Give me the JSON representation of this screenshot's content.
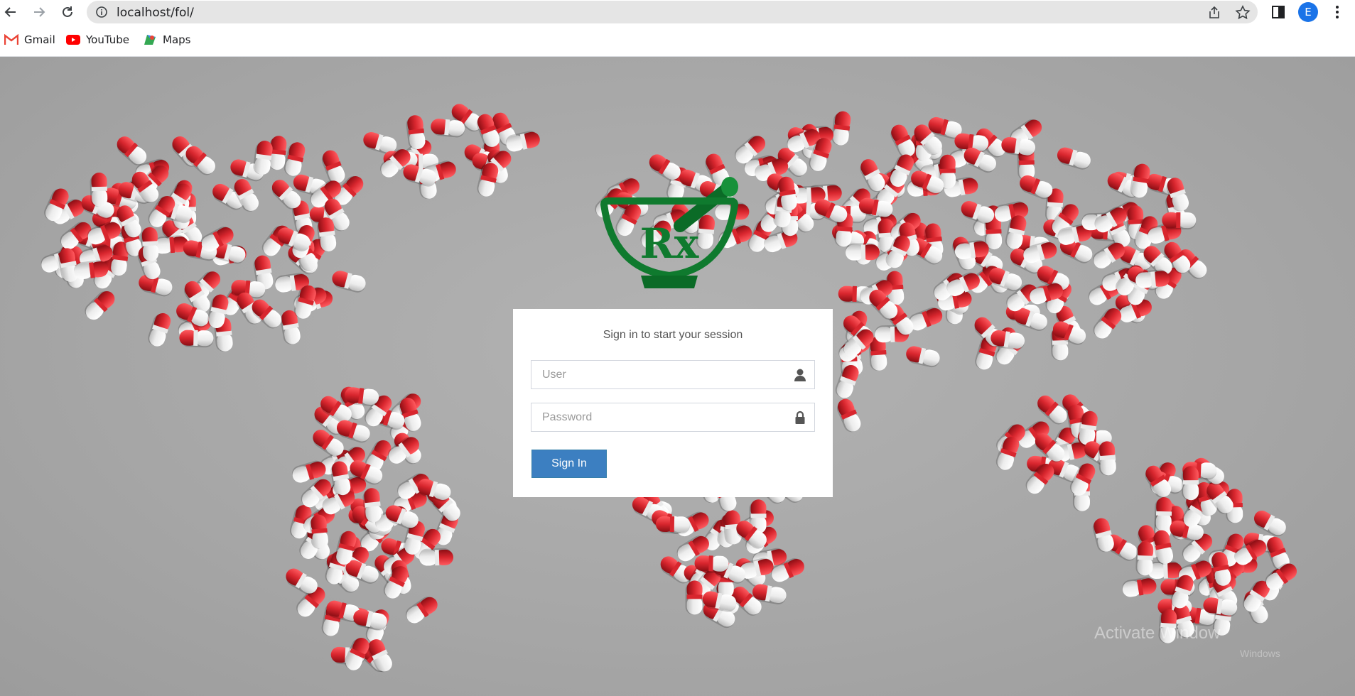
{
  "browser": {
    "url": "localhost/fol/",
    "profile_initial": "E",
    "bookmarks": [
      {
        "label": "Gmail",
        "icon": "gmail-icon"
      },
      {
        "label": "YouTube",
        "icon": "youtube-icon"
      },
      {
        "label": "Maps",
        "icon": "maps-icon"
      }
    ]
  },
  "login": {
    "message": "Sign in to start your session",
    "user_placeholder": "User",
    "password_placeholder": "Password",
    "signin_label": "Sign In"
  },
  "logo": {
    "text": "Rx",
    "color": "#0f7a2e"
  },
  "watermark": {
    "line1": "Activate Window",
    "line2": "Windows"
  },
  "colors": {
    "primary_button": "#3c7fc1",
    "pill_red": "#d8262e",
    "pill_white": "#f2f2f2",
    "background": "#a7a7a7"
  }
}
